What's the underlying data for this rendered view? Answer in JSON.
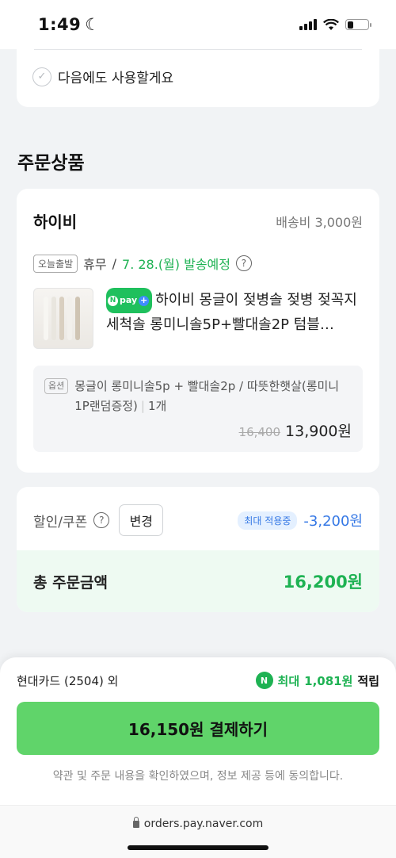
{
  "status_bar": {
    "time": "1:49",
    "moon": "☾"
  },
  "reuse": {
    "label": "다음에도 사용할게요",
    "check_mark": "✓"
  },
  "section_title": "주문상품",
  "order": {
    "seller": "하이비",
    "shipping_fee": "배송비 3,000원",
    "ship_tag": "오늘출발",
    "ship_day": "휴무",
    "ship_slash": "/",
    "ship_date": "7. 28.(월) 발송예정",
    "help": "?",
    "npay_label": "pay",
    "npay_n": "N",
    "npay_plus": "+",
    "product_name": "하이비 몽글이 젖병솔 젖병 젖꼭지 세척솔 롱미니솔5P+빨대솔2P 텀블…",
    "option_tag": "옵션",
    "option_text": "몽글이 롱미니솔5p + 빨대솔2p / 따뜻한햇살(롱미니1P랜덤증정)",
    "option_qty": "1개",
    "original_price": "16,400",
    "price": "13,900원"
  },
  "totals": {
    "coupon_label": "할인/쿠폰",
    "help": "?",
    "change_button": "변경",
    "max_badge": "최대 적용중",
    "discount": "-3,200원",
    "total_label": "총 주문금액",
    "total_value": "16,200원"
  },
  "payment": {
    "card": "현대카드 (2504) 외",
    "reward_icon": "N",
    "reward_max": "최대",
    "reward_points": "1,081원",
    "reward_tail": "적립",
    "pay_button": "16,150원 결제하기",
    "agreement": "약관 및 주문 내용을 확인하였으며, 정보 제공 등에 동의합니다.",
    "url": "orders.pay.naver.com"
  },
  "colors": {
    "accent_green": "#1eb253",
    "pay_button": "#60d46a",
    "discount_blue": "#3578e5"
  }
}
